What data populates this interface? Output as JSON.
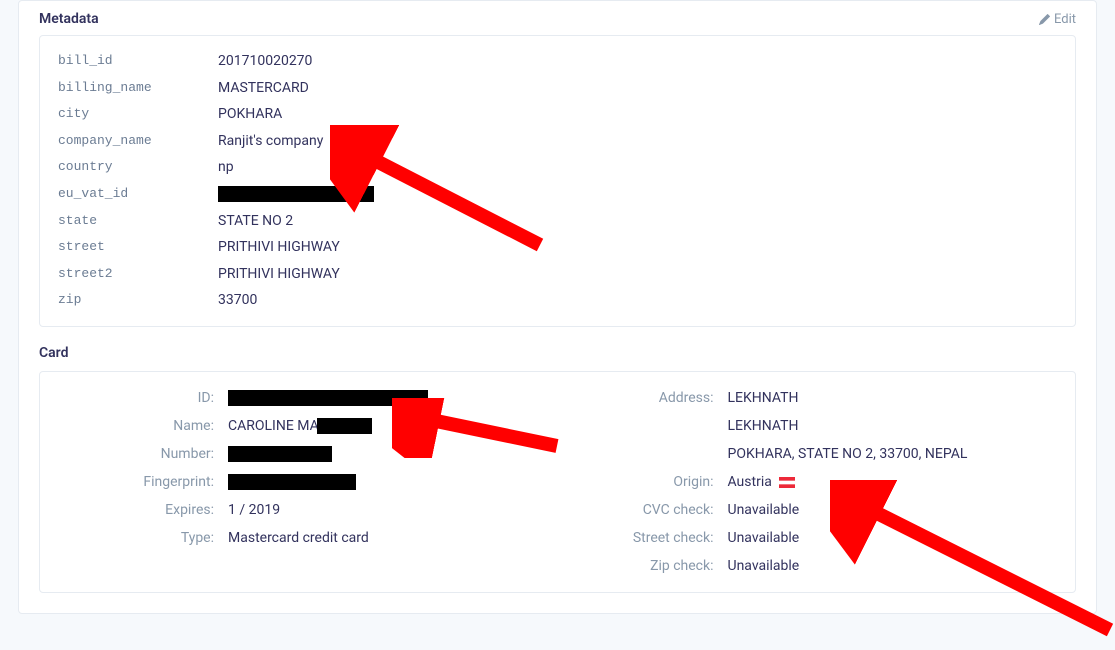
{
  "metadata_section": {
    "title": "Metadata",
    "edit_label": "Edit",
    "rows": [
      {
        "key": "bill_id",
        "value": "201710020270"
      },
      {
        "key": "billing_name",
        "value": "MASTERCARD"
      },
      {
        "key": "city",
        "value": "POKHARA"
      },
      {
        "key": "company_name",
        "value": "Ranjit's company"
      },
      {
        "key": "country",
        "value": "np"
      },
      {
        "key": "eu_vat_id",
        "value": "[redacted]"
      },
      {
        "key": "state",
        "value": "STATE NO 2"
      },
      {
        "key": "street",
        "value": "PRITHIVI HIGHWAY"
      },
      {
        "key": "street2",
        "value": "PRITHIVI HIGHWAY"
      },
      {
        "key": "zip",
        "value": "33700"
      }
    ]
  },
  "card_section": {
    "title": "Card",
    "left": {
      "id_label": "ID:",
      "id_value": "[redacted]",
      "name_label": "Name:",
      "name_value_prefix": "CAROLINE MA",
      "number_label": "Number:",
      "number_value": "[redacted]",
      "fingerprint_label": "Fingerprint:",
      "fingerprint_value": "[redacted]",
      "expires_label": "Expires:",
      "expires_value": "1 / 2019",
      "type_label": "Type:",
      "type_value": "Mastercard credit card"
    },
    "right": {
      "address_label": "Address:",
      "address_line1": "LEKHNATH",
      "address_line2": "LEKHNATH",
      "address_line3": "POKHARA, STATE NO 2, 33700, NEPAL",
      "origin_label": "Origin:",
      "origin_value": "Austria",
      "cvc_label": "CVC check:",
      "cvc_value": "Unavailable",
      "street_label": "Street check:",
      "street_value": "Unavailable",
      "zip_label": "Zip check:",
      "zip_value": "Unavailable"
    }
  },
  "annotations": {
    "arrow1_target": "company_name value",
    "arrow2_target": "card ID value",
    "arrow3_target": "origin Austria"
  }
}
